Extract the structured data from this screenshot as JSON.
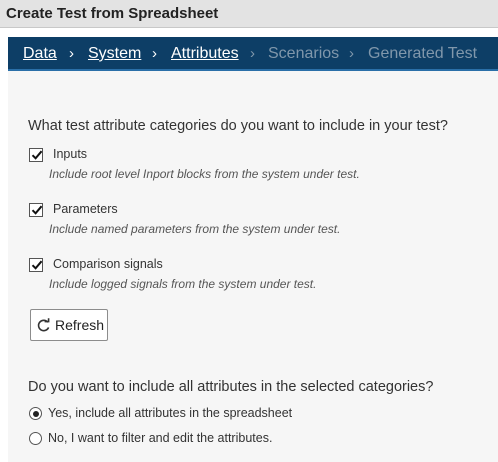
{
  "window": {
    "title": "Create Test from Spreadsheet"
  },
  "breadcrumb": {
    "items": [
      {
        "label": "Data",
        "state": "active"
      },
      {
        "label": "System",
        "state": "active"
      },
      {
        "label": "Attributes",
        "state": "active"
      },
      {
        "label": "Scenarios",
        "state": "inactive"
      },
      {
        "label": "Generated Test",
        "state": "inactive"
      }
    ],
    "separator": "›"
  },
  "categories": {
    "question": "What test attribute categories do you want to include in your test?",
    "options": [
      {
        "label": "Inputs",
        "description": "Include root level Inport blocks from the system under test.",
        "checked": true
      },
      {
        "label": "Parameters",
        "description": "Include named parameters from the system under test.",
        "checked": true
      },
      {
        "label": "Comparison signals",
        "description": "Include logged signals from the system under test.",
        "checked": true
      }
    ]
  },
  "refresh": {
    "label": "Refresh",
    "icon": "refresh-icon"
  },
  "include_all": {
    "question": "Do you want to include all attributes in the selected categories?",
    "options": [
      {
        "label": "Yes, include all attributes in the spreadsheet",
        "selected": true
      },
      {
        "label": "No, I want to filter and edit the attributes.",
        "selected": false
      }
    ]
  },
  "colors": {
    "navbar": "#0d3e66",
    "navbar_border": "#2a6fa8",
    "nav_active": "#ffffff",
    "nav_inactive": "#8097ab",
    "titlebar": "#e3e3e3",
    "panel": "#f6f6f6"
  }
}
